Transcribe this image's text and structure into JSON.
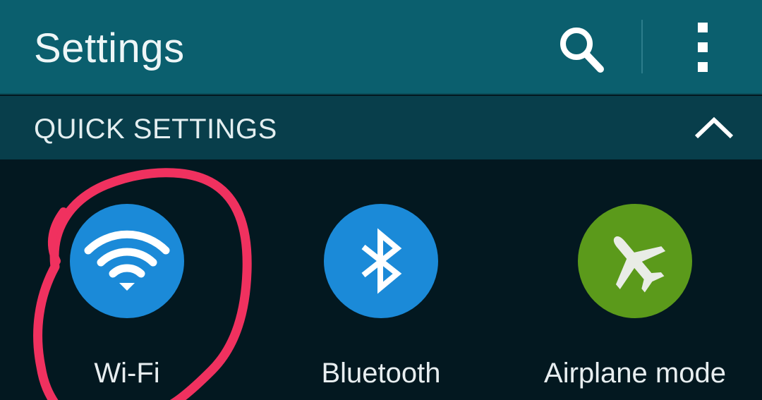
{
  "app_bar": {
    "title": "Settings",
    "background_color": "#0b5f6e",
    "search_icon": "search-icon",
    "menu_icon": "more-vertical-icon"
  },
  "section": {
    "title": "QUICK SETTINGS",
    "collapse_icon": "chevron-up-icon",
    "background_color": "#083e4b"
  },
  "tiles": [
    {
      "label": "Wi-Fi",
      "icon": "wifi-icon",
      "color": "#1b8ad8",
      "state": "on",
      "highlighted": true
    },
    {
      "label": "Bluetooth",
      "icon": "bluetooth-icon",
      "color": "#1b8ad8",
      "state": "on",
      "highlighted": false
    },
    {
      "label": "Airplane mode",
      "icon": "airplane-icon",
      "color": "#5b9a1b",
      "state": "on",
      "highlighted": false
    }
  ],
  "annotation": {
    "color": "#f0315f",
    "target": "Wi-Fi"
  }
}
